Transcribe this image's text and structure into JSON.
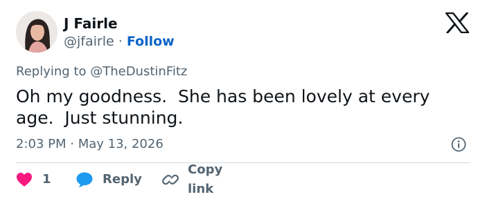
{
  "author": {
    "display_name": "J Fairle",
    "handle": "@jfairle",
    "separator": "·",
    "follow_label": "Follow"
  },
  "reply_context": {
    "prefix": "Replying to",
    "mention": "@TheDustinFitz"
  },
  "tweet": {
    "text": "Oh my goodness.  She has been lovely at every age.  Just stunning.",
    "timestamp": "2:03 PM · May 13, 2026"
  },
  "actions": {
    "like_count": "1",
    "reply_label": "Reply",
    "copy_link_label": "Copy link"
  },
  "icons": {
    "brand": "x-logo-icon",
    "like": "heart-icon",
    "reply": "speech-bubble-icon",
    "copy": "link-icon",
    "info": "info-icon"
  },
  "colors": {
    "text_primary": "#0f1419",
    "text_secondary": "#536471",
    "link_blue": "#0a64c8",
    "like_pink": "#f91880",
    "reply_blue": "#1d9bf0",
    "divider": "#cfd9de"
  }
}
